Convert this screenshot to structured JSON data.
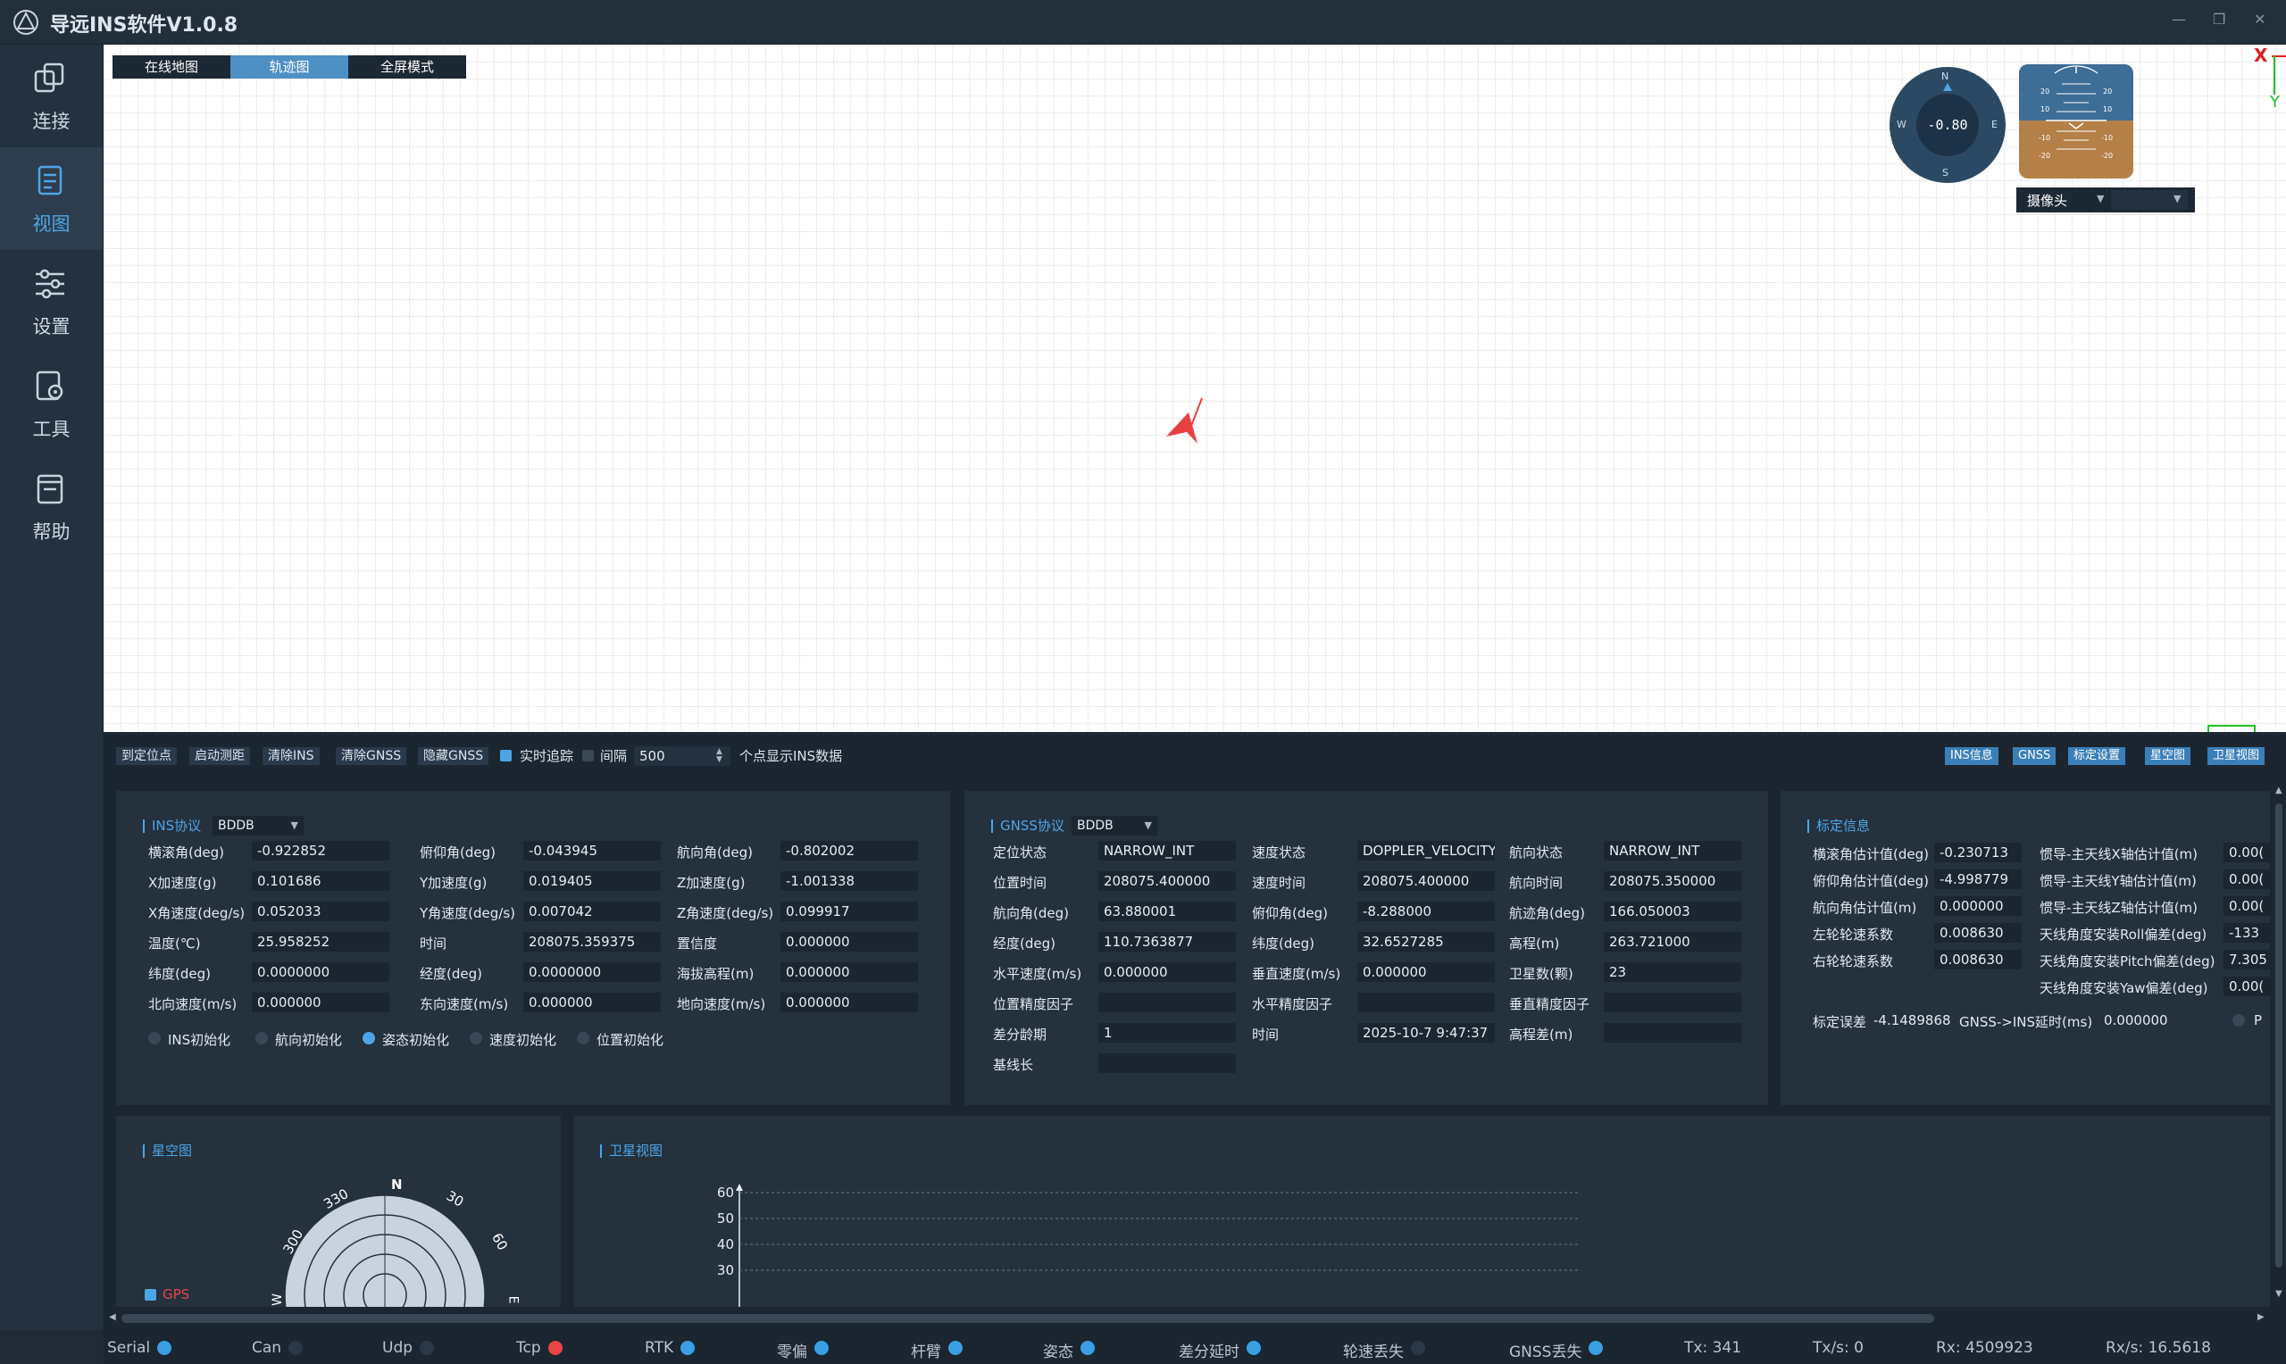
{
  "app": {
    "title": "导远INS软件V1.0.8"
  },
  "sidebar": {
    "items": [
      {
        "label": "连接",
        "icon": "link-copy-icon"
      },
      {
        "label": "视图",
        "icon": "view-document-icon"
      },
      {
        "label": "设置",
        "icon": "sliders-icon"
      },
      {
        "label": "工具",
        "icon": "tools-icon"
      },
      {
        "label": "帮助",
        "icon": "book-icon"
      }
    ],
    "active_index": 1
  },
  "map": {
    "tabs": [
      "在线地图",
      "轨迹图",
      "全屏模式"
    ],
    "active_tab": 1,
    "compass": {
      "value": "-0.80",
      "n": "N",
      "s": "S",
      "e": "E",
      "w": "W"
    },
    "attitude_ticks": [
      "20",
      "20",
      "10",
      "10",
      "-10",
      "-10",
      "-20",
      "-20"
    ],
    "camera": {
      "label": "摄像头",
      "value": ""
    },
    "axis": {
      "x": "X",
      "y": "Y"
    },
    "track_color": "#e84040"
  },
  "toolbar": {
    "buttons": [
      "到定位点",
      "启动测距",
      "清除INS",
      "清除GNSS",
      "隐藏GNSS"
    ],
    "realtime_label": "实时追踪",
    "realtime_checked": true,
    "interval_label": "间隔",
    "interval_checked": false,
    "interval_value": "500",
    "interval_suffix": "个点显示INS数据",
    "right_buttons": [
      "INS信息",
      "GNSS",
      "标定设置",
      "星空图",
      "卫星视图"
    ]
  },
  "ins": {
    "title": "INS协议",
    "protocol": "BDDB",
    "rows": [
      [
        {
          "l": "横滚角(deg)",
          "v": "-0.922852"
        },
        {
          "l": "俯仰角(deg)",
          "v": "-0.043945"
        },
        {
          "l": "航向角(deg)",
          "v": "-0.802002"
        }
      ],
      [
        {
          "l": "X加速度(g)",
          "v": "0.101686"
        },
        {
          "l": "Y加速度(g)",
          "v": "0.019405"
        },
        {
          "l": "Z加速度(g)",
          "v": "-1.001338"
        }
      ],
      [
        {
          "l": "X角速度(deg/s)",
          "v": "0.052033"
        },
        {
          "l": "Y角速度(deg/s)",
          "v": "0.007042"
        },
        {
          "l": "Z角速度(deg/s)",
          "v": "0.099917"
        }
      ],
      [
        {
          "l": "温度(℃)",
          "v": "25.958252"
        },
        {
          "l": "时间",
          "v": "208075.359375"
        },
        {
          "l": "置信度",
          "v": "0.000000"
        }
      ],
      [
        {
          "l": "纬度(deg)",
          "v": "0.0000000"
        },
        {
          "l": "经度(deg)",
          "v": "0.0000000"
        },
        {
          "l": "海拔高程(m)",
          "v": "0.000000"
        }
      ],
      [
        {
          "l": "北向速度(m/s)",
          "v": "0.000000"
        },
        {
          "l": "东向速度(m/s)",
          "v": "0.000000"
        },
        {
          "l": "地向速度(m/s)",
          "v": "0.000000"
        }
      ]
    ],
    "init": [
      {
        "l": "INS初始化",
        "on": false
      },
      {
        "l": "航向初始化",
        "on": false
      },
      {
        "l": "姿态初始化",
        "on": true
      },
      {
        "l": "速度初始化",
        "on": false
      },
      {
        "l": "位置初始化",
        "on": false
      }
    ]
  },
  "gnss": {
    "title": "GNSS协议",
    "protocol": "BDDB",
    "rows": [
      [
        {
          "l": "定位状态",
          "v": "NARROW_INT"
        },
        {
          "l": "速度状态",
          "v": "DOPPLER_VELOCITY"
        },
        {
          "l": "航向状态",
          "v": "NARROW_INT"
        }
      ],
      [
        {
          "l": "位置时间",
          "v": "208075.400000"
        },
        {
          "l": "速度时间",
          "v": "208075.400000"
        },
        {
          "l": "航向时间",
          "v": "208075.350000"
        }
      ],
      [
        {
          "l": "航向角(deg)",
          "v": "63.880001"
        },
        {
          "l": "俯仰角(deg)",
          "v": "-8.288000"
        },
        {
          "l": "航迹角(deg)",
          "v": "166.050003"
        }
      ],
      [
        {
          "l": "经度(deg)",
          "v": "110.7363877"
        },
        {
          "l": "纬度(deg)",
          "v": "32.6527285"
        },
        {
          "l": "高程(m)",
          "v": "263.721000"
        }
      ],
      [
        {
          "l": "水平速度(m/s)",
          "v": "0.000000"
        },
        {
          "l": "垂直速度(m/s)",
          "v": "0.000000"
        },
        {
          "l": "卫星数(颗)",
          "v": "23"
        }
      ],
      [
        {
          "l": "位置精度因子",
          "v": ""
        },
        {
          "l": "水平精度因子",
          "v": ""
        },
        {
          "l": "垂直精度因子",
          "v": ""
        }
      ],
      [
        {
          "l": "差分龄期",
          "v": "1"
        },
        {
          "l": "时间",
          "v": "2025-10-7 9:47:37"
        },
        {
          "l": "高程差(m)",
          "v": ""
        }
      ],
      [
        {
          "l": "基线长",
          "v": ""
        }
      ]
    ]
  },
  "calib": {
    "title": "标定信息",
    "left": [
      {
        "l": "横滚角估计值(deg)",
        "v": "-0.230713"
      },
      {
        "l": "俯仰角估计值(deg)",
        "v": "-4.998779"
      },
      {
        "l": "航向角估计值(m)",
        "v": "0.000000"
      },
      {
        "l": "左轮轮速系数",
        "v": "0.008630"
      },
      {
        "l": "右轮轮速系数",
        "v": "0.008630"
      }
    ],
    "right": [
      {
        "l": "惯导-主天线X轴估计值(m)",
        "v": "0.00("
      },
      {
        "l": "惯导-主天线Y轴估计值(m)",
        "v": "0.00("
      },
      {
        "l": "惯导-主天线Z轴估计值(m)",
        "v": "0.00("
      },
      {
        "l": "天线角度安装Roll偏差(deg)",
        "v": "-133"
      },
      {
        "l": "天线角度安装Pitch偏差(deg)",
        "v": "7.305"
      },
      {
        "l": "天线角度安装Yaw偏差(deg)",
        "v": "0.00("
      }
    ],
    "bottom_label1": "标定误差",
    "bottom_value1": "-4.1489868",
    "bottom_label2": "GNSS->INS延时(ms)",
    "bottom_value2": "0.000000",
    "bottom_trunc": "P"
  },
  "skyview": {
    "title": "星空图",
    "labels": {
      "n": "N",
      "a330": "330",
      "a30": "30",
      "a300": "300",
      "a60": "60",
      "w": "W",
      "e": "E"
    },
    "gps_label": "GPS",
    "gps_checked": true
  },
  "satview": {
    "title": "卫星视图",
    "y_ticks": [
      "60",
      "50",
      "40",
      "30"
    ]
  },
  "chart_data": {
    "type": "bar",
    "title": "卫星视图",
    "categories": [],
    "values": [],
    "ylim": [
      0,
      60
    ],
    "grid": true,
    "visible_ticks": [
      60,
      50,
      40,
      30
    ]
  },
  "status": {
    "items": [
      {
        "l": "Serial",
        "c": "#3aa0e6"
      },
      {
        "l": "Can",
        "c": "#2b3845"
      },
      {
        "l": "Udp",
        "c": "#2b3845"
      },
      {
        "l": "Tcp",
        "c": "#e84545"
      },
      {
        "l": "RTK",
        "c": "#3aa0e6"
      },
      {
        "l": "零偏",
        "c": "#3aa0e6"
      },
      {
        "l": "杆臂",
        "c": "#3aa0e6"
      },
      {
        "l": "姿态",
        "c": "#3aa0e6"
      },
      {
        "l": "差分延时",
        "c": "#3aa0e6"
      },
      {
        "l": "轮速丢失",
        "c": "#2b3845"
      },
      {
        "l": "GNSS丢失",
        "c": "#3aa0e6"
      }
    ],
    "tx": "Tx: 341",
    "txs": "Tx/s: 0",
    "rx": "Rx: 4509923",
    "rxs": "Rx/s: 16.5618"
  }
}
